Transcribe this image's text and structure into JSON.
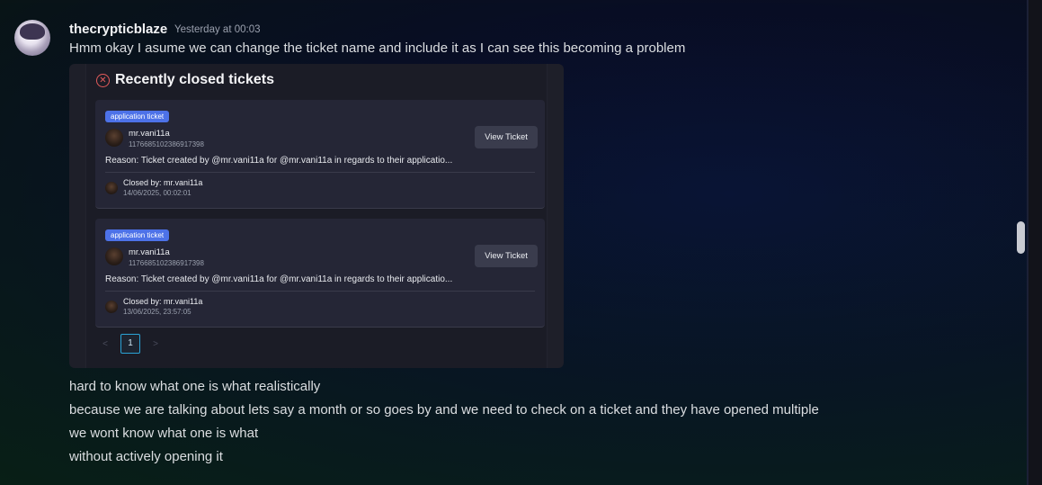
{
  "message": {
    "author": "thecrypticblaze",
    "timestamp": "Yesterday at 00:03",
    "lines": [
      "Hmm okay I asume we can change the ticket name and include it as I can see this becoming a problem",
      "hard to know what one is what realistically",
      "because we are talking about lets say a month or so goes by and we need to check on a ticket and they have opened multiple",
      "we wont know what one is what",
      "without actively opening it"
    ]
  },
  "embed": {
    "title": "Recently closed tickets",
    "tickets": [
      {
        "badge": "application ticket",
        "user": "mr.vani11a",
        "user_id": "1176685102386917398",
        "view_button": "View Ticket",
        "reason": "Reason: Ticket created by @mr.vani11a for @mr.vani11a in regards to their applicatio...",
        "closed_by": "Closed by: mr.vani11a",
        "closed_time": "14/06/2025, 00:02:01"
      },
      {
        "badge": "application ticket",
        "user": "mr.vani11a",
        "user_id": "1176685102386917398",
        "view_button": "View Ticket",
        "reason": "Reason: Ticket created by @mr.vani11a for @mr.vani11a in regards to their applicatio...",
        "closed_by": "Closed by: mr.vani11a",
        "closed_time": "13/06/2025, 23:57:05"
      }
    ],
    "pagination": {
      "prev": "<",
      "current": "1",
      "next": ">"
    }
  },
  "colors": {
    "badge": "#4d72e8",
    "close_icon": "#e35b5b",
    "page_active": "#2aa3d6"
  }
}
